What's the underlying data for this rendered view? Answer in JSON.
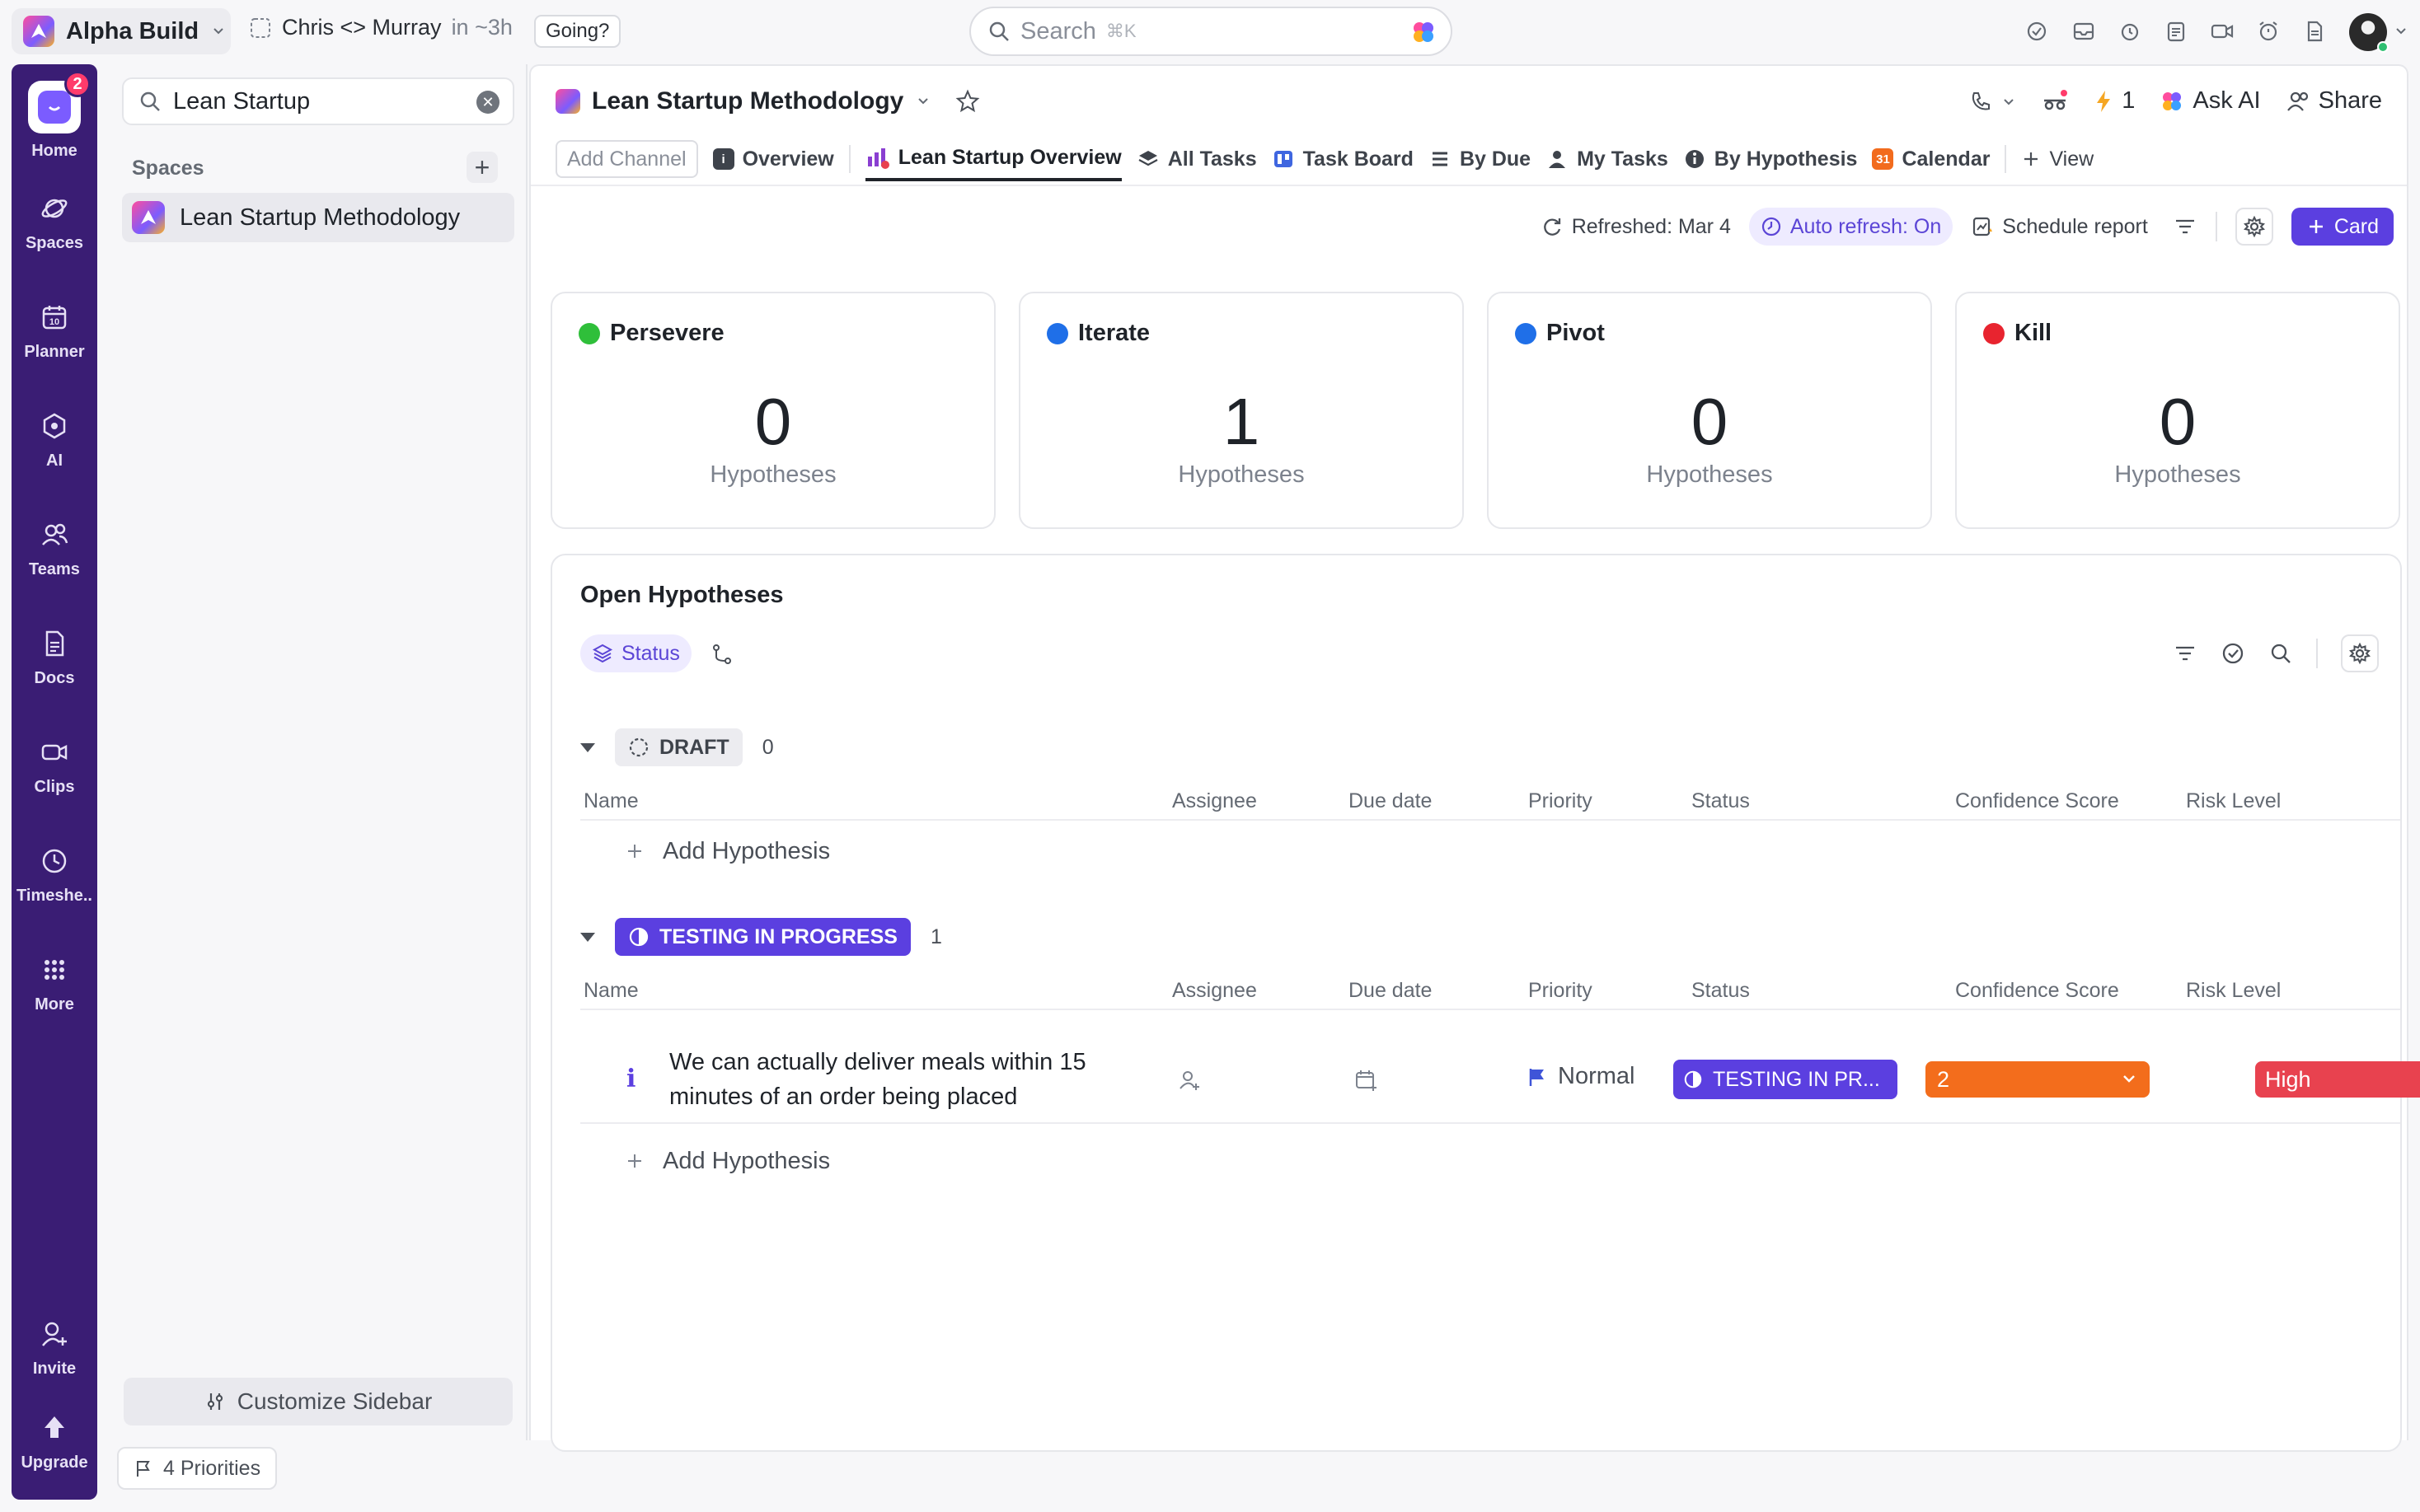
{
  "topbar": {
    "workspace": "Alpha Build",
    "meeting_title": "Chris <> Murray",
    "meeting_time": "in ~3h",
    "going_label": "Going?",
    "search_placeholder": "Search",
    "search_shortcut": "⌘K"
  },
  "rail": {
    "home_badge": "2",
    "items": [
      "Home",
      "Spaces",
      "Planner",
      "AI",
      "Teams",
      "Docs",
      "Clips",
      "Timeshe..",
      "More"
    ],
    "invite": "Invite",
    "upgrade": "Upgrade"
  },
  "sidebar": {
    "search_value": "Lean Startup",
    "spaces_label": "Spaces",
    "space_name": "Lean Startup Methodology",
    "customize_label": "Customize Sidebar"
  },
  "footer": {
    "priorities_label": "4 Priorities"
  },
  "main": {
    "title": "Lean Startup Methodology",
    "header_right": {
      "lightning_count": "1",
      "ask_ai": "Ask AI",
      "share": "Share"
    },
    "tabs": {
      "add_channel": "Add Channel",
      "overview": "Overview",
      "lean_overview": "Lean Startup Overview",
      "all_tasks": "All Tasks",
      "task_board": "Task Board",
      "by_due": "By Due",
      "my_tasks": "My Tasks",
      "by_hypothesis": "By Hypothesis",
      "calendar": "Calendar",
      "calendar_day": "31",
      "view": "View"
    },
    "toolbar": {
      "refreshed": "Refreshed: Mar 4",
      "auto_refresh": "Auto refresh: On",
      "schedule": "Schedule report",
      "card": "Card"
    },
    "cards": [
      {
        "title": "Persevere",
        "value": "0",
        "label": "Hypotheses",
        "color": "#2fbf3a"
      },
      {
        "title": "Iterate",
        "value": "1",
        "label": "Hypotheses",
        "color": "#1f6fe8"
      },
      {
        "title": "Pivot",
        "value": "0",
        "label": "Hypotheses",
        "color": "#1f6fe8"
      },
      {
        "title": "Kill",
        "value": "0",
        "label": "Hypotheses",
        "color": "#e8242f"
      }
    ],
    "hypotheses": {
      "title": "Open Hypotheses",
      "status_chip": "Status",
      "columns": [
        "Name",
        "Assignee",
        "Due date",
        "Priority",
        "Status",
        "Confidence Score",
        "Risk Level"
      ],
      "groups": [
        {
          "status": "DRAFT",
          "count": "0",
          "add_label": "Add Hypothesis"
        },
        {
          "status": "TESTING IN PROGRESS",
          "count": "1",
          "add_label": "Add Hypothesis"
        }
      ],
      "task": {
        "name": "We can actually deliver meals within 15 minutes of an order being placed",
        "priority": "Normal",
        "status": "TESTING IN PR...",
        "confidence": "2",
        "risk": "High"
      }
    }
  }
}
